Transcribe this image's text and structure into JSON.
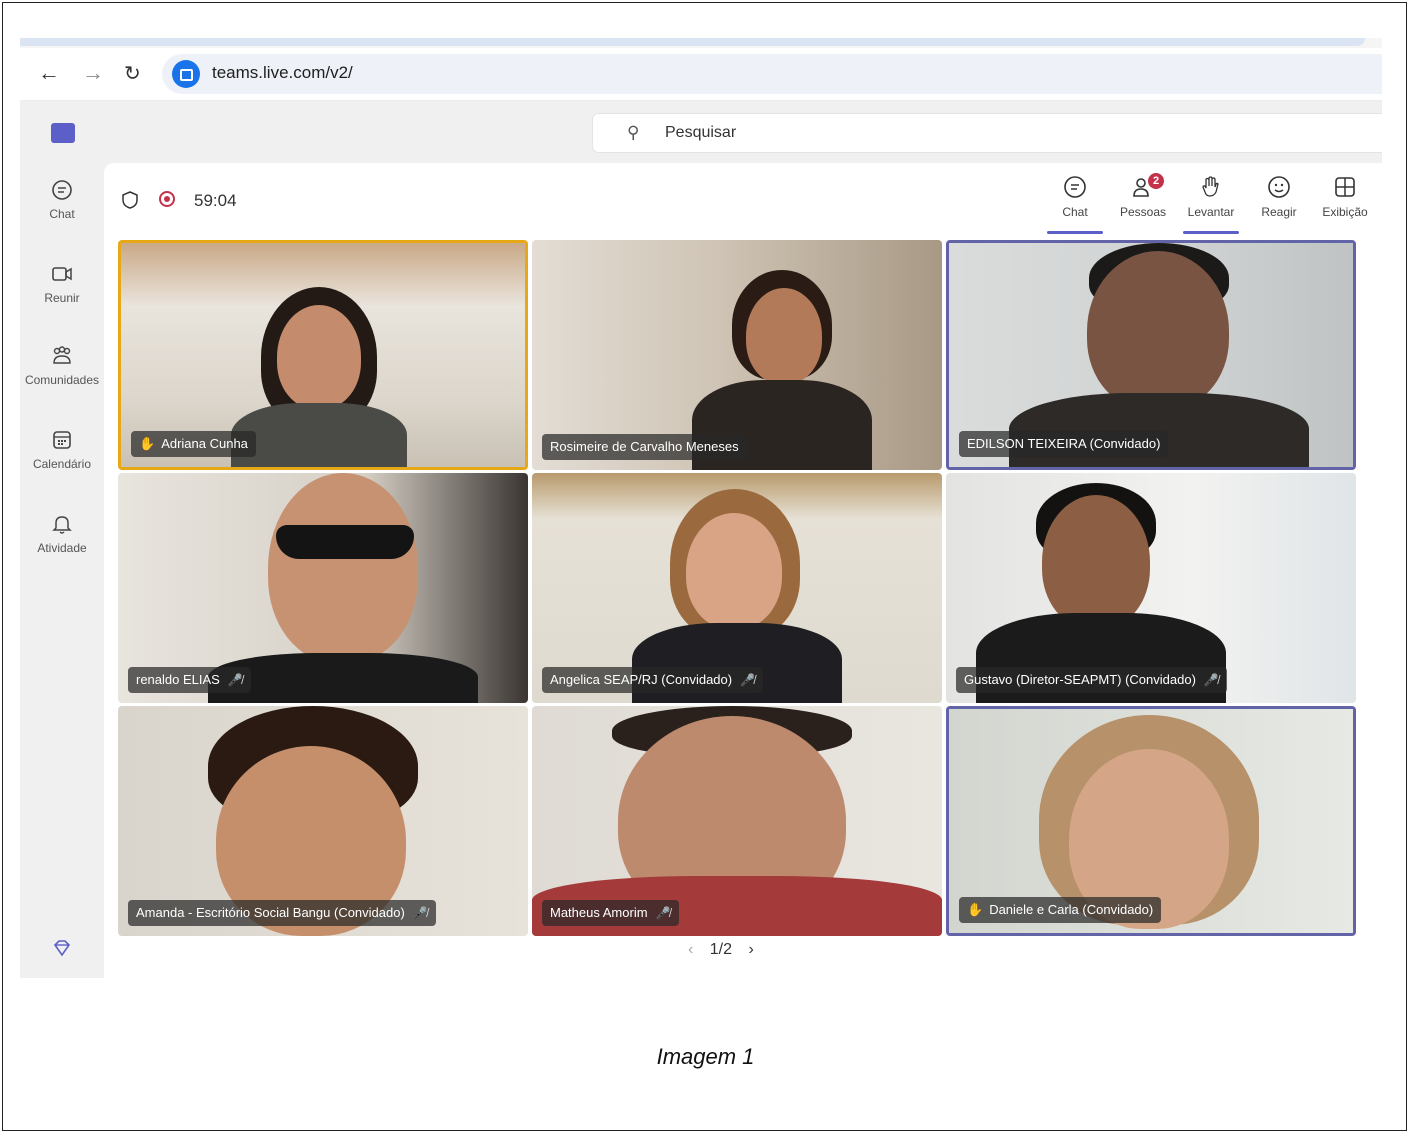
{
  "browser": {
    "url": "teams.live.com/v2/",
    "back_icon": "arrow-left-icon",
    "forward_icon": "arrow-right-icon",
    "reload_icon": "reload-icon"
  },
  "search": {
    "placeholder": "Pesquisar"
  },
  "rail": {
    "items": [
      {
        "label": "Chat",
        "icon": "chat-icon"
      },
      {
        "label": "Reunir",
        "icon": "video-icon"
      },
      {
        "label": "Comunidades",
        "icon": "communities-icon"
      },
      {
        "label": "Calendário",
        "icon": "calendar-icon"
      },
      {
        "label": "Atividade",
        "icon": "bell-icon"
      }
    ]
  },
  "meeting": {
    "timer": "59:04",
    "toolbar": {
      "chat": "Chat",
      "people": "Pessoas",
      "people_badge": "2",
      "raise": "Levantar",
      "react": "Reagir",
      "view": "Exibição"
    },
    "participants": [
      {
        "name": "Adriana Cunha",
        "hand_raised": true,
        "muted": false
      },
      {
        "name": "Rosimeire de Carvalho Meneses",
        "hand_raised": false,
        "muted": false
      },
      {
        "name": "EDILSON TEIXEIRA (Convidado)",
        "hand_raised": false,
        "muted": false
      },
      {
        "name": "renaldo ELIAS",
        "hand_raised": false,
        "muted": true
      },
      {
        "name": "Angelica SEAP/RJ (Convidado)",
        "hand_raised": false,
        "muted": true
      },
      {
        "name": "Gustavo (Diretor-SEAPMT) (Convidado)",
        "hand_raised": false,
        "muted": true
      },
      {
        "name": "Amanda - Escritório Social Bangu (Convidado)",
        "hand_raised": false,
        "muted": true
      },
      {
        "name": "Matheus Amorim",
        "hand_raised": false,
        "muted": true
      },
      {
        "name": "Daniele e Carla (Convidado)",
        "hand_raised": true,
        "muted": false
      }
    ],
    "pager": "1/2"
  },
  "caption": "Imagem 1",
  "colors": {
    "brand": "#5b5fc7",
    "record": "#c4314b",
    "hand": "#f2b01e"
  }
}
